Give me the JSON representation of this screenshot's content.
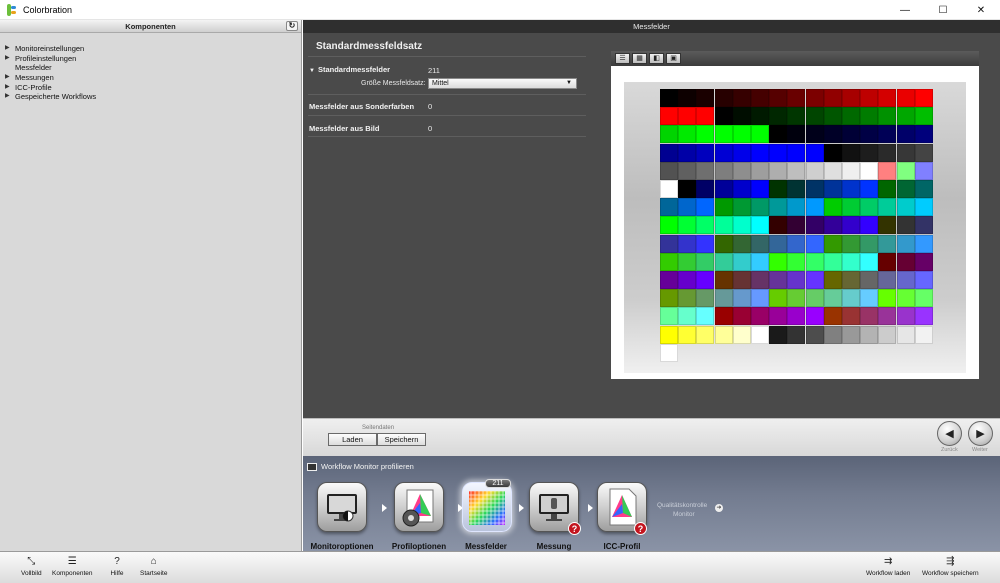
{
  "window": {
    "title": "Colorbration",
    "minimize": "—",
    "maximize": "☐",
    "close": "✕"
  },
  "left_panel": {
    "header": "Komponenten",
    "refresh_icon": "↻",
    "tree": [
      {
        "label": "Monitoreinstellungen",
        "expandable": true
      },
      {
        "label": "Profileinstellungen",
        "expandable": true
      },
      {
        "label": "Messfelder",
        "expandable": false
      },
      {
        "label": "Messungen",
        "expandable": true
      },
      {
        "label": "ICC-Profile",
        "expandable": true
      },
      {
        "label": "Gespeicherte Workflows",
        "expandable": true
      }
    ]
  },
  "main": {
    "header": "Messfelder",
    "section_title": "Standardmessfeldsatz",
    "standard": {
      "label": "Standardmessfelder",
      "value": "211"
    },
    "size": {
      "label": "Größe Messfeldsatz:",
      "value": "Mittel"
    },
    "spot": {
      "label": "Messfelder aus Sonderfarben",
      "value": "0"
    },
    "image": {
      "label": "Messfelder aus Bild",
      "value": "0"
    }
  },
  "preview": {
    "toolbar": [
      "list-icon",
      "grid-icon",
      "gradient-icon",
      "image-icon"
    ],
    "patch_count": 211,
    "columns": 15,
    "colors": [
      "#000000",
      "#0d0000",
      "#1a0000",
      "#270000",
      "#360000",
      "#450000",
      "#560000",
      "#690000",
      "#7c0000",
      "#910000",
      "#a70000",
      "#be0000",
      "#d40000",
      "#ea0000",
      "#ff0000",
      "#ff0000",
      "#ff0000",
      "#ff0000",
      "#000000",
      "#000d00",
      "#001a00",
      "#002700",
      "#003600",
      "#004500",
      "#005600",
      "#006900",
      "#007c00",
      "#009100",
      "#00a700",
      "#00be00",
      "#00d400",
      "#00ea00",
      "#00ff00",
      "#00ff00",
      "#00ff00",
      "#00ff00",
      "#000000",
      "#00000d",
      "#00001a",
      "#000027",
      "#000036",
      "#000045",
      "#000056",
      "#000069",
      "#00007c",
      "#000091",
      "#0000a7",
      "#0000be",
      "#0000d4",
      "#0000ea",
      "#0000ff",
      "#0000ff",
      "#0000ff",
      "#0000ff",
      "#000000",
      "#111111",
      "#1d1d1d",
      "#2a2a2a",
      "#373737",
      "#444444",
      "#525252",
      "#606060",
      "#6f6f6f",
      "#7e7e7e",
      "#8e8e8e",
      "#9e9e9e",
      "#aeaeae",
      "#bebebe",
      "#cfcfcf",
      "#dfdfdf",
      "#efefef",
      "#ffffff",
      "#ff8080",
      "#80ff80",
      "#8080ff",
      "#ffffff",
      "#000000",
      "#000066",
      "#000099",
      "#0000cc",
      "#0000ff",
      "#003300",
      "#003333",
      "#003366",
      "#003399",
      "#0033cc",
      "#0033ff",
      "#006600",
      "#006633",
      "#006666",
      "#006699",
      "#0066cc",
      "#0066ff",
      "#009900",
      "#009933",
      "#009966",
      "#009999",
      "#0099cc",
      "#0099ff",
      "#00cc00",
      "#00cc33",
      "#00cc66",
      "#00cc99",
      "#00cccc",
      "#00ccff",
      "#00ff00",
      "#00ff33",
      "#00ff66",
      "#00ff99",
      "#00ffcc",
      "#00ffff",
      "#330000",
      "#330033",
      "#330066",
      "#330099",
      "#3300cc",
      "#3300ff",
      "#333300",
      "#333333",
      "#333366",
      "#333399",
      "#3333cc",
      "#3333ff",
      "#336600",
      "#336633",
      "#336666",
      "#336699",
      "#3366cc",
      "#3366ff",
      "#339900",
      "#339933",
      "#339966",
      "#339999",
      "#3399cc",
      "#3399ff",
      "#33cc00",
      "#33cc33",
      "#33cc66",
      "#33cc99",
      "#33cccc",
      "#33ccff",
      "#33ff00",
      "#33ff33",
      "#33ff66",
      "#33ff99",
      "#33ffcc",
      "#33ffff",
      "#660000",
      "#660033",
      "#660066",
      "#660099",
      "#6600cc",
      "#6600ff",
      "#663300",
      "#663333",
      "#663366",
      "#663399",
      "#6633cc",
      "#6633ff",
      "#666600",
      "#666633",
      "#666666",
      "#666699",
      "#6666cc",
      "#6666ff",
      "#669900",
      "#669933",
      "#669966",
      "#669999",
      "#6699cc",
      "#6699ff",
      "#66cc00",
      "#66cc33",
      "#66cc66",
      "#66cc99",
      "#66cccc",
      "#66ccff",
      "#66ff00",
      "#66ff33",
      "#66ff66",
      "#66ff99",
      "#66ffcc",
      "#66ffff",
      "#990000",
      "#990033",
      "#990066",
      "#990099",
      "#9900cc",
      "#9900ff",
      "#993300",
      "#993333",
      "#993366",
      "#993399",
      "#9933cc",
      "#9933ff",
      "#ffff00",
      "#ffff33",
      "#ffff66",
      "#ffff99",
      "#ffffcc",
      "#ffffff",
      "#1a1a1a",
      "#333333",
      "#4d4d4d",
      "#808080",
      "#999999",
      "#b3b3b3",
      "#cccccc",
      "#e6e6e6",
      "#f2f2f2",
      "#ffffff"
    ]
  },
  "seitendaten": {
    "label": "Seitendaten",
    "load": "Laden",
    "save": "Speichern"
  },
  "nav": {
    "back": "Zurück",
    "next": "Weiter"
  },
  "workflow": {
    "title": "Workflow Monitor profilieren",
    "steps": [
      {
        "label": "Monitoroptionen",
        "icon": "monitor-icon"
      },
      {
        "label": "Profiloptionen",
        "icon": "profile-gear-icon"
      },
      {
        "label": "Messfelder",
        "icon": "patches-icon",
        "badge": "211"
      },
      {
        "label": "Messung",
        "icon": "measurement-icon",
        "warning": "?"
      },
      {
        "label": "ICC-Profil",
        "icon": "icc-profile-icon",
        "warning": "?"
      }
    ],
    "quality_line1": "Qualitätskontrolle",
    "quality_line2": "Monitor"
  },
  "bottombar": {
    "fullscreen": "Vollbild",
    "components": "Komponenten",
    "help": "Hilfe",
    "home": "Startseite",
    "workflow_load": "Workflow laden",
    "workflow_save": "Workflow speichern"
  }
}
